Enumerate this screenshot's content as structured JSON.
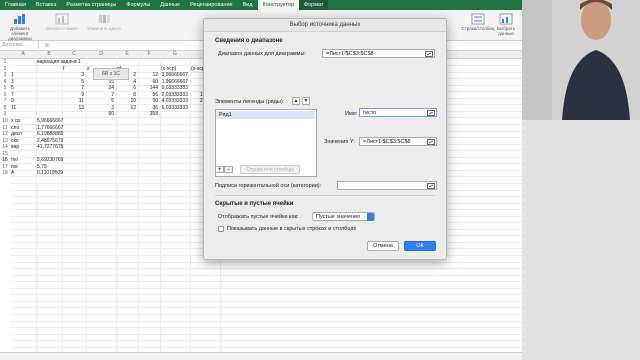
{
  "ribbon": {
    "tabs": [
      "Главная",
      "Вставка",
      "Разметка страницы",
      "Формулы",
      "Данные",
      "Рецензирование",
      "Вид",
      "Конструктор",
      "Формат"
    ],
    "buttons": {
      "add_element": "Добавить элемент диаграммы",
      "express_layout": "Экспресс-макет",
      "change_colors": "Изменить цвета",
      "switch_rowcol": "Строка/столбец",
      "select_data": "Выбрать данные"
    }
  },
  "formula_bar": {
    "name_box": "Диаграм...",
    "fx": "fx"
  },
  "sheet": {
    "columns": [
      "A",
      "B",
      "C",
      "D",
      "E",
      "F",
      "G",
      "H"
    ],
    "rows": [
      {
        "n": "1",
        "cells": [
          {
            "c": "B",
            "v": "вариация задача 1"
          }
        ]
      },
      {
        "n": "2",
        "cells": [
          {
            "c": "C",
            "v": "f"
          },
          {
            "c": "D",
            "v": "x'"
          },
          {
            "c": "E",
            "v": "xf"
          },
          {
            "c": "G",
            "v": "(x-xср)"
          },
          {
            "c": "H",
            "v": "(x-xср)^"
          }
        ]
      },
      {
        "n": "3",
        "cells": [
          {
            "c": "A",
            "v": "1"
          },
          {
            "c": "C",
            "v": "3"
          },
          {
            "c": "D",
            "v": "6"
          },
          {
            "c": "E",
            "v": "2"
          },
          {
            "c": "F",
            "v": "12"
          },
          {
            "c": "G",
            "v": "3,96666667"
          }
        ]
      },
      {
        "n": "4",
        "cells": [
          {
            "c": "A",
            "v": "3"
          },
          {
            "c": "C",
            "v": "5"
          },
          {
            "c": "D",
            "v": "15"
          },
          {
            "c": "E",
            "v": "4"
          },
          {
            "c": "F",
            "v": "60"
          },
          {
            "c": "G",
            "v": "1,96666667"
          }
        ]
      },
      {
        "n": "5",
        "cells": [
          {
            "c": "A",
            "v": "5"
          },
          {
            "c": "C",
            "v": "7"
          },
          {
            "c": "D",
            "v": "24"
          },
          {
            "c": "E",
            "v": "6"
          },
          {
            "c": "F",
            "v": "144"
          },
          {
            "c": "G",
            "v": "0,03333333"
          }
        ]
      },
      {
        "n": "6",
        "cells": [
          {
            "c": "A",
            "v": "7"
          },
          {
            "c": "C",
            "v": "9"
          },
          {
            "c": "D",
            "v": "7"
          },
          {
            "c": "E",
            "v": "8"
          },
          {
            "c": "F",
            "v": "56"
          },
          {
            "c": "G",
            "v": "2,03333333"
          },
          {
            "c": "H",
            "v": "14,2333"
          }
        ]
      },
      {
        "n": "7",
        "cells": [
          {
            "c": "A",
            "v": "9"
          },
          {
            "c": "C",
            "v": "11"
          },
          {
            "c": "D",
            "v": "5"
          },
          {
            "c": "E",
            "v": "10"
          },
          {
            "c": "F",
            "v": "50"
          },
          {
            "c": "G",
            "v": "4,03333333"
          },
          {
            "c": "H",
            "v": "20,1666"
          }
        ]
      },
      {
        "n": "8",
        "cells": [
          {
            "c": "A",
            "v": "11"
          },
          {
            "c": "C",
            "v": "13"
          },
          {
            "c": "D",
            "v": "3"
          },
          {
            "c": "E",
            "v": "12"
          },
          {
            "c": "F",
            "v": "36"
          },
          {
            "c": "G",
            "v": "6,03333333"
          }
        ]
      },
      {
        "n": "9",
        "cells": [
          {
            "c": "D",
            "v": "60"
          },
          {
            "c": "F",
            "v": "358"
          }
        ]
      },
      {
        "n": "10",
        "cells": [
          {
            "c": "A",
            "v": "x ср"
          },
          {
            "c": "B",
            "v": "5,96666667"
          }
        ]
      },
      {
        "n": "11",
        "cells": [
          {
            "c": "A",
            "v": "сло"
          },
          {
            "c": "B",
            "v": "1,77666667"
          }
        ]
      },
      {
        "n": "12",
        "cells": [
          {
            "c": "A",
            "v": "дисп"
          },
          {
            "c": "B",
            "v": "6,19888889"
          }
        ]
      },
      {
        "n": "13",
        "cells": [
          {
            "c": "A",
            "v": "ско"
          },
          {
            "c": "B",
            "v": "2,48975679"
          }
        ]
      },
      {
        "n": "14",
        "cells": [
          {
            "c": "A",
            "v": "вар"
          },
          {
            "c": "B",
            "v": "41,7277675"
          }
        ]
      },
      {
        "n": "15",
        "cells": []
      },
      {
        "n": "16",
        "cells": [
          {
            "c": "A",
            "v": "mo"
          },
          {
            "c": "B",
            "v": "5,69230769"
          }
        ]
      },
      {
        "n": "17",
        "cells": [
          {
            "c": "A",
            "v": "me"
          },
          {
            "c": "B",
            "v": "5,75"
          }
        ]
      },
      {
        "n": "18",
        "cells": [
          {
            "c": "A",
            "v": "A"
          },
          {
            "c": "B",
            "v": "0,11019509"
          }
        ]
      }
    ],
    "chart_tooltip": "6R x 1C"
  },
  "dialog": {
    "title": "Выбор источника данных",
    "range_section": "Сведения о диапазоне",
    "range_label": "Диапазон данных для диаграммы:",
    "range_value": "=Лист1!$C$3:$C$8",
    "legend_label": "Элементы легенды (ряды):",
    "series": [
      "Ряд1"
    ],
    "name_label": "Имя:",
    "name_value": "гисто",
    "values_label": "Значения Y:",
    "values_value": "=Лист1!$C$3:$C$8",
    "plus": "+",
    "minus": "−",
    "rows_cols_btn": "Строки или столбцы",
    "axis_label": "Подписи горизонтальной оси (категории):",
    "axis_value": "",
    "hidden_section": "Скрытые и пустые ячейки",
    "empty_label": "Отображать пустые ячейки как:",
    "empty_value": "Пустые значения",
    "hidden_checkbox": "Показывать данные в скрытых строках и столбцах",
    "cancel": "Отмена",
    "ok": "ОК"
  }
}
